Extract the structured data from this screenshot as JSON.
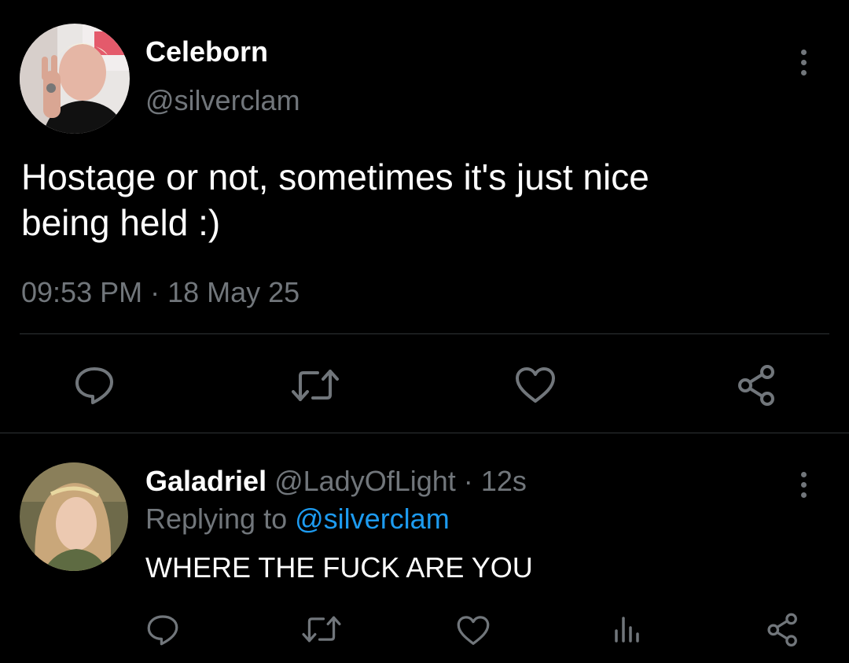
{
  "tweet": {
    "display_name": "Celeborn",
    "handle": "@silverclam",
    "text_line1": "Hostage or not, sometimes it's just nice",
    "text_line2": "being held :)",
    "timestamp": "09:53 PM · 18 May 25",
    "action_icons": [
      "reply-icon",
      "retweet-icon",
      "like-icon",
      "share-icon"
    ]
  },
  "reply": {
    "display_name": "Galadriel",
    "handle": "@LadyOfLight",
    "separator": "·",
    "age": "12s",
    "replying_prefix": "Replying to",
    "replying_handle": "@silverclam",
    "text": "WHERE THE FUCK ARE YOU",
    "action_icons": [
      "reply-icon",
      "retweet-icon",
      "like-icon",
      "analytics-icon",
      "share-icon"
    ]
  },
  "colors": {
    "background": "#000000",
    "text": "#ffffff",
    "muted": "#71767b",
    "link": "#1d9bf0",
    "divider": "#2f3336"
  }
}
